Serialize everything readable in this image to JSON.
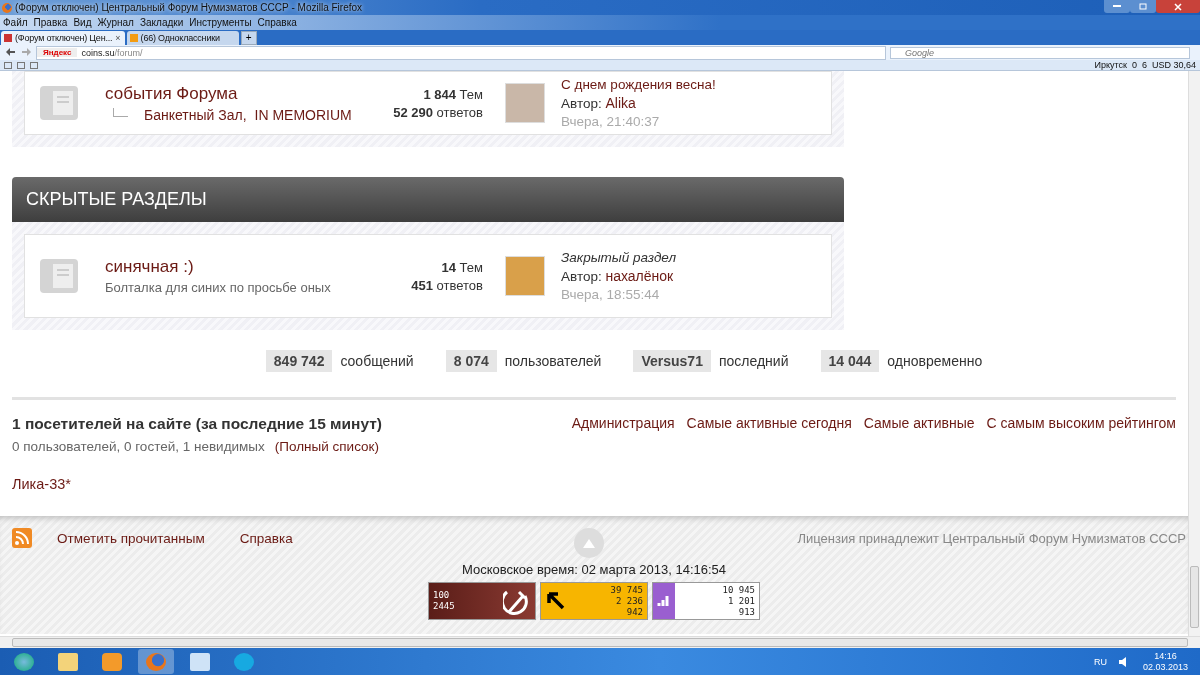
{
  "browser": {
    "title": "(Форум отключен) Центральный Форум Нумизматов СССР - Mozilla Firefox",
    "menu": [
      "Файл",
      "Правка",
      "Вид",
      "Журнал",
      "Закладки",
      "Инструменты",
      "Справка"
    ],
    "tabs": [
      {
        "label": "(Форум отключен) Цен...",
        "selected": true,
        "close": "×"
      },
      {
        "label": "(66) Одноклассники",
        "selected": false
      }
    ],
    "new_tab": "+",
    "address": {
      "brand": "Яндекс",
      "host": "coins.su",
      "path": "/forum/"
    },
    "search": {
      "placeholder": "Google"
    },
    "status": {
      "city": "Иркутск",
      "weather": "0",
      "mail": "6",
      "currency": "USD 30,64"
    }
  },
  "forums": [
    {
      "title": "события Форума",
      "subforums": [
        "Банкетный Зал,",
        "IN MEMORIUM"
      ],
      "topics": "1 844",
      "topics_label": "Тем",
      "posts": "52 290",
      "posts_label": "ответов",
      "last_post": {
        "kind": "link",
        "title": "С днем рождения весна!",
        "author_label": "Автор:",
        "author": "Alika",
        "time": "Вчера, 21:40:37"
      }
    }
  ],
  "section": {
    "title": "СКРЫТЫЕ РАЗДЕЛЫ",
    "forums": [
      {
        "title": "синячная :)",
        "description": "Болталка для синих по просьбе оных",
        "topics": "14",
        "topics_label": "Тем",
        "posts": "451",
        "posts_label": "ответов",
        "last_post": {
          "kind": "closed",
          "title": "Закрытый раздел",
          "author_label": "Автор:",
          "author": "нахалёнок",
          "time": "Вчера, 18:55:44"
        }
      }
    ]
  },
  "stats": [
    {
      "value": "849 742",
      "label": "сообщений"
    },
    {
      "value": "8 074",
      "label": "пользователей"
    },
    {
      "value": "Versus71",
      "label": "последний"
    },
    {
      "value": "14 044",
      "label": "одновременно"
    }
  ],
  "online": {
    "title": "1 посетителей на сайте (за последние 15 минут)",
    "summary": "0 пользователей, 0 гостей, 1 невидимых",
    "full_list": "(Полный список)",
    "links": [
      "Администрация",
      "Самые активные сегодня",
      "Самые активные",
      "С самым высоким рейтингом"
    ],
    "users": [
      "Лика-33*"
    ]
  },
  "footer": {
    "links": [
      "Отметить прочитанным",
      "Справка"
    ],
    "license": "Лицензия принадлежит Центральный Форум Нумизматов СССР",
    "time": "Московское время: 02 марта 2013, 14:16:54",
    "counters": [
      {
        "kind": "sickle",
        "lines": [
          "100",
          "2445"
        ]
      },
      {
        "kind": "arrow",
        "lines": [
          "39 745",
          "2 236",
          "942"
        ]
      },
      {
        "kind": "bars",
        "lines": [
          "10 945",
          "1 201",
          "913"
        ]
      }
    ]
  },
  "taskbar": {
    "lang": "RU",
    "time": "14:16",
    "date": "02.03.2013"
  }
}
